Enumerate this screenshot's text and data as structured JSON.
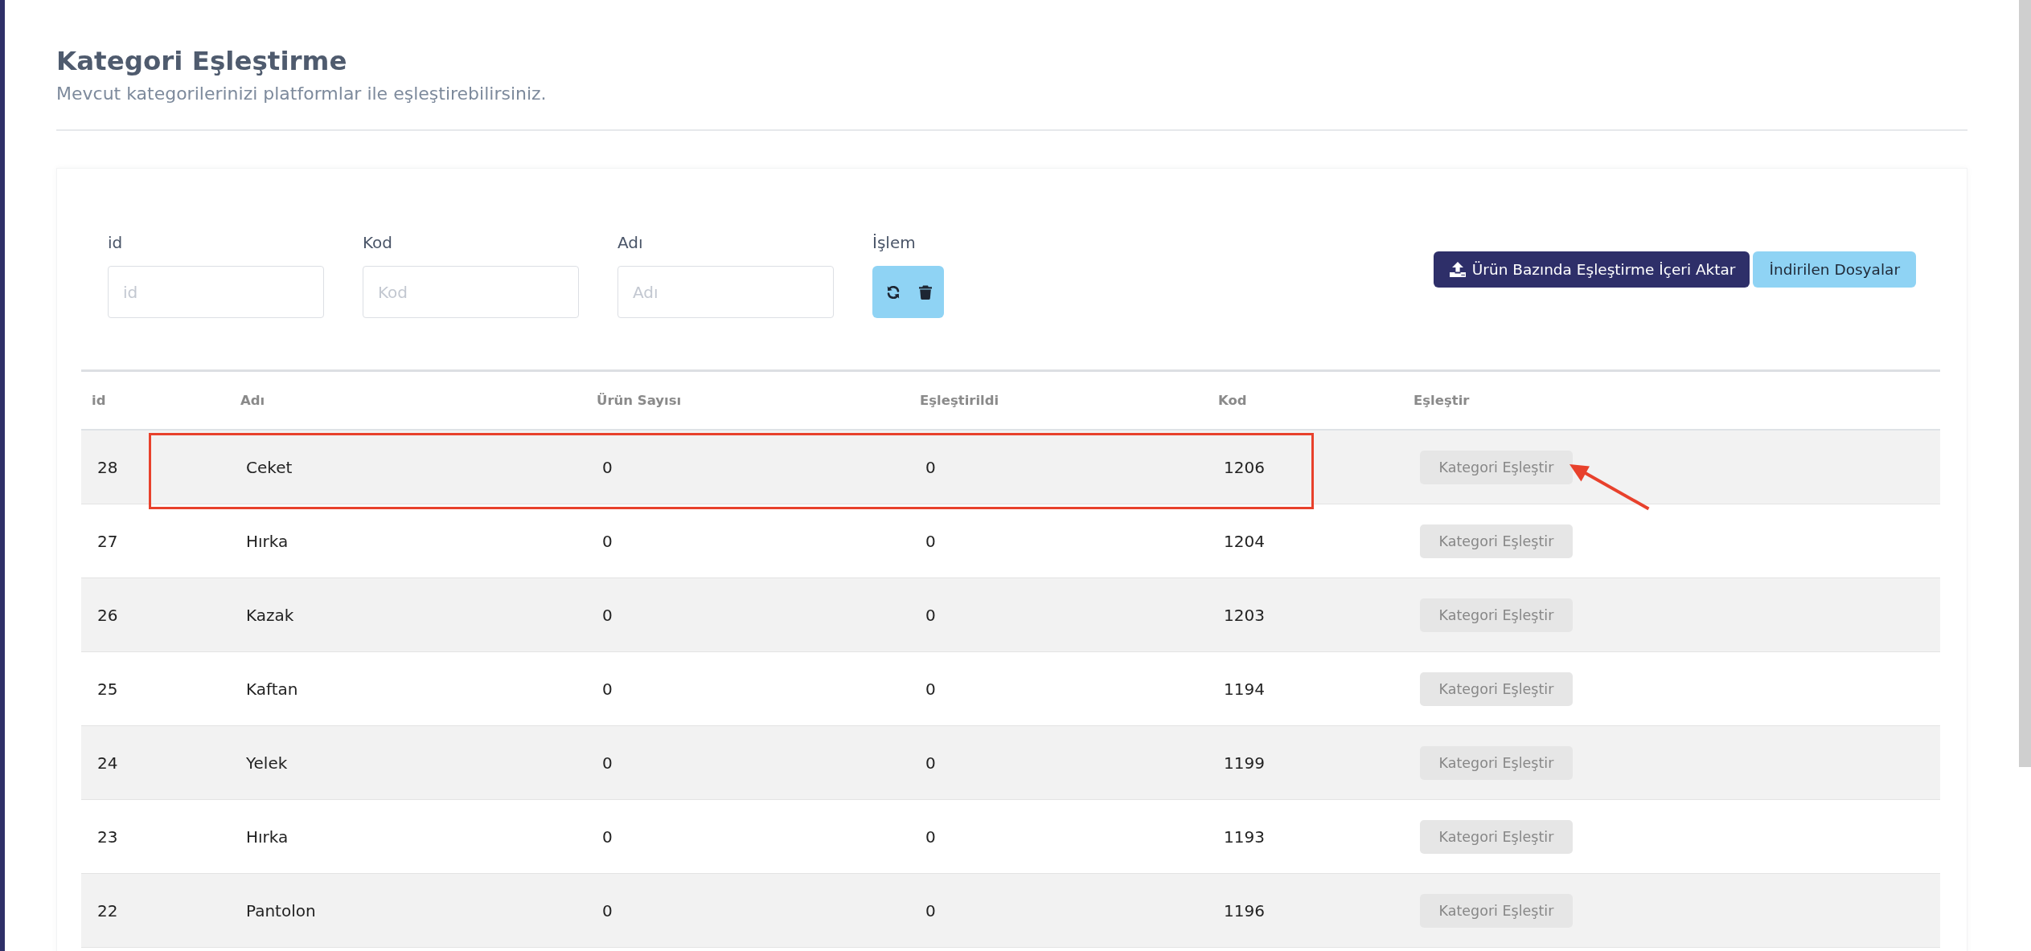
{
  "page": {
    "title": "Kategori Eşleştirme",
    "subtitle": "Mevcut kategorilerinizi platformlar ile eşleştirebilirsiniz."
  },
  "filters": [
    {
      "label": "id",
      "placeholder": "id"
    },
    {
      "label": "Kod",
      "placeholder": "Kod"
    },
    {
      "label": "Adı",
      "placeholder": "Adı"
    }
  ],
  "actions": {
    "label": "İşlem"
  },
  "toolbar_buttons": [
    {
      "label": "Ürün Bazında Eşleştirme İçeri Aktar",
      "kind": "primary"
    },
    {
      "label": "İndirilen Dosyalar",
      "kind": "info"
    }
  ],
  "table": {
    "columns": [
      "id",
      "Adı",
      "Ürün Sayısı",
      "Eşleştirildi",
      "Kod",
      "Eşleştir"
    ],
    "rows": [
      {
        "id": "28",
        "name": "Ceket",
        "product_count": "0",
        "matched": "0",
        "code": "1206",
        "button": "Kategori Eşleştir",
        "highlighted": true,
        "arrow": true
      },
      {
        "id": "27",
        "name": "Hırka",
        "product_count": "0",
        "matched": "0",
        "code": "1204",
        "button": "Kategori Eşleştir",
        "highlighted": false,
        "arrow": false
      },
      {
        "id": "26",
        "name": "Kazak",
        "product_count": "0",
        "matched": "0",
        "code": "1203",
        "button": "Kategori Eşleştir",
        "highlighted": false,
        "arrow": false
      },
      {
        "id": "25",
        "name": "Kaftan",
        "product_count": "0",
        "matched": "0",
        "code": "1194",
        "button": "Kategori Eşleştir",
        "highlighted": false,
        "arrow": false
      },
      {
        "id": "24",
        "name": "Yelek",
        "product_count": "0",
        "matched": "0",
        "code": "1199",
        "button": "Kategori Eşleştir",
        "highlighted": false,
        "arrow": false
      },
      {
        "id": "23",
        "name": "Hırka",
        "product_count": "0",
        "matched": "0",
        "code": "1193",
        "button": "Kategori Eşleştir",
        "highlighted": false,
        "arrow": false
      },
      {
        "id": "22",
        "name": "Pantolon",
        "product_count": "0",
        "matched": "0",
        "code": "1196",
        "button": "Kategori Eşleştir",
        "highlighted": false,
        "arrow": false
      }
    ]
  }
}
